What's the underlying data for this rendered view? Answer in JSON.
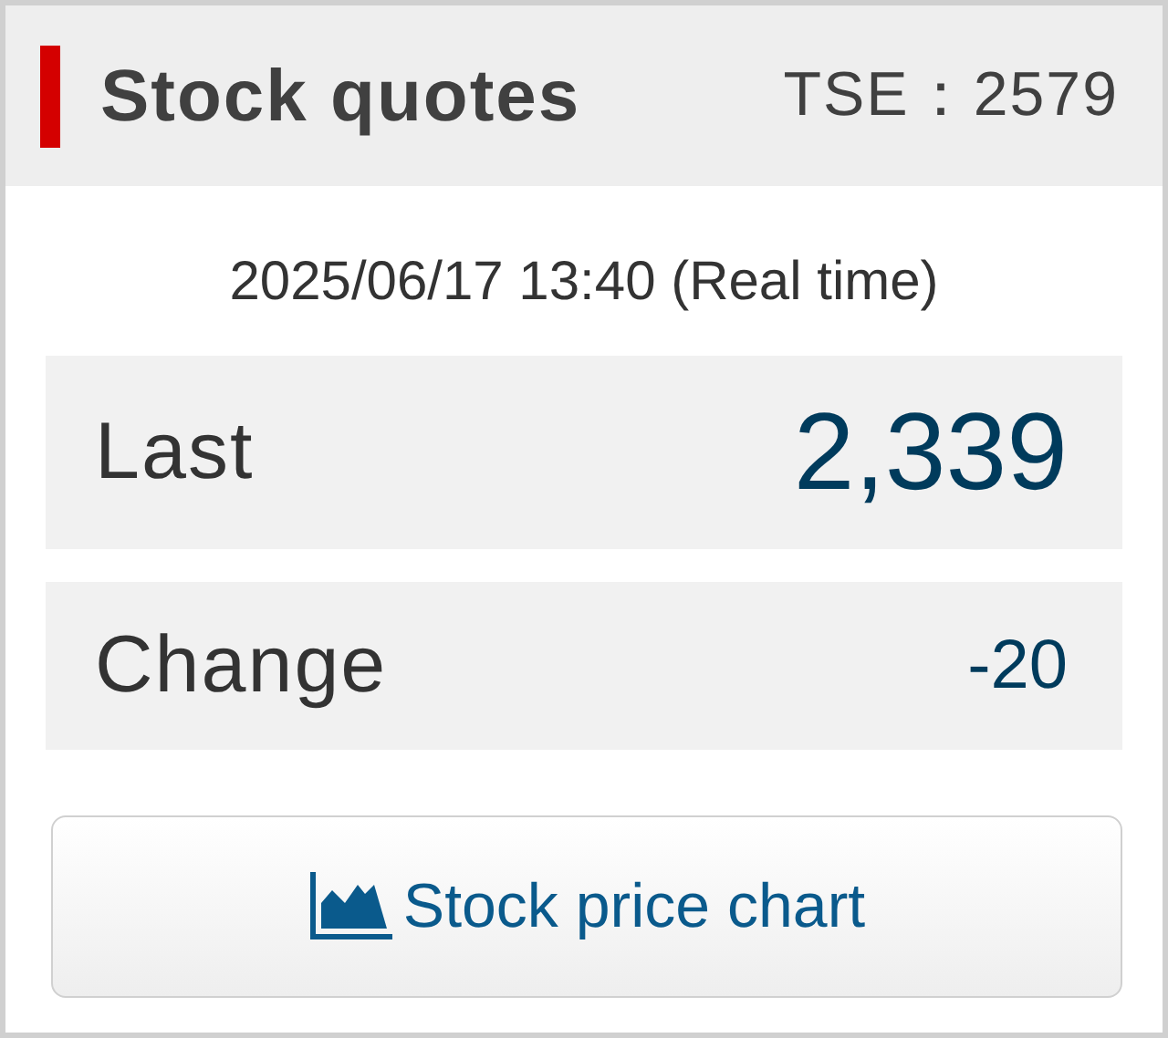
{
  "header": {
    "title": "Stock quotes",
    "code": "TSE：2579"
  },
  "timestamp": "2025/06/17 13:40 (Real time)",
  "quotes": [
    {
      "label": "Last",
      "value": "2,339",
      "kind": "large"
    },
    {
      "label": "Change",
      "value": "-20",
      "kind": "small"
    }
  ],
  "chart_button": {
    "label": "Stock price chart"
  }
}
